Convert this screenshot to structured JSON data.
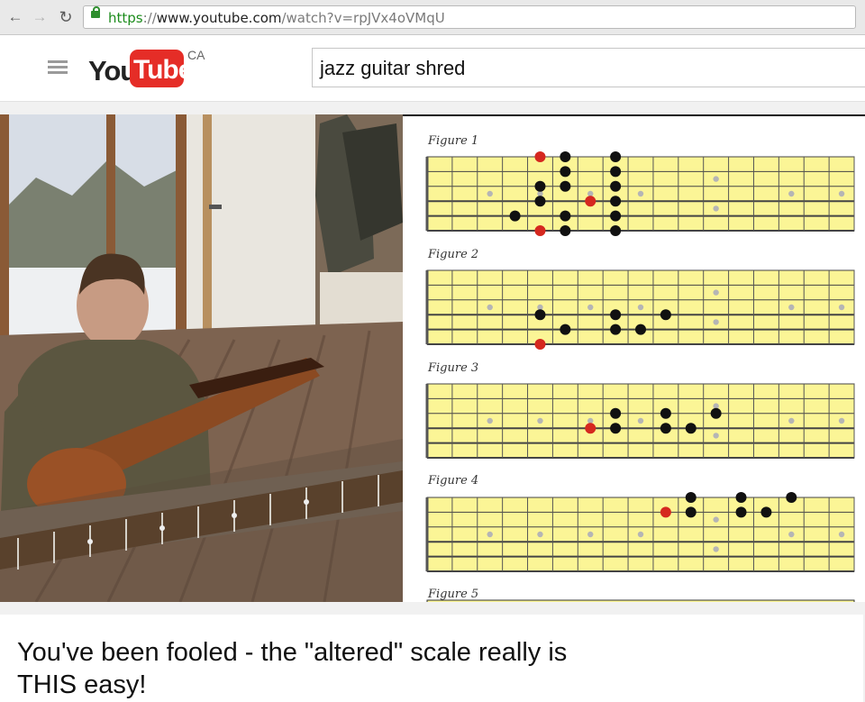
{
  "browser": {
    "url_scheme": "https",
    "url_sep": "://",
    "url_host": "www.youtube.com",
    "url_rest": "/watch?v=rpJVx4oVMqU",
    "icons": [
      "back-arrow-icon",
      "forward-arrow-icon",
      "reload-icon",
      "lock-icon"
    ]
  },
  "youtube": {
    "logo_you": "You",
    "logo_tube": "Tube",
    "country": "CA",
    "search_query": "jazz guitar shred",
    "brand_red": "#e52d27"
  },
  "video": {
    "figures": [
      {
        "label": "Figure 1"
      },
      {
        "label": "Figure 2"
      },
      {
        "label": "Figure 3"
      },
      {
        "label": "Figure 4"
      },
      {
        "label": "Figure 5"
      }
    ],
    "fretboard_color": "#fbf596",
    "root_marker_color": "#d5281f",
    "note_marker_color": "#111111"
  },
  "title": "You've been fooled - the \"altered\" scale really is THIS easy!"
}
